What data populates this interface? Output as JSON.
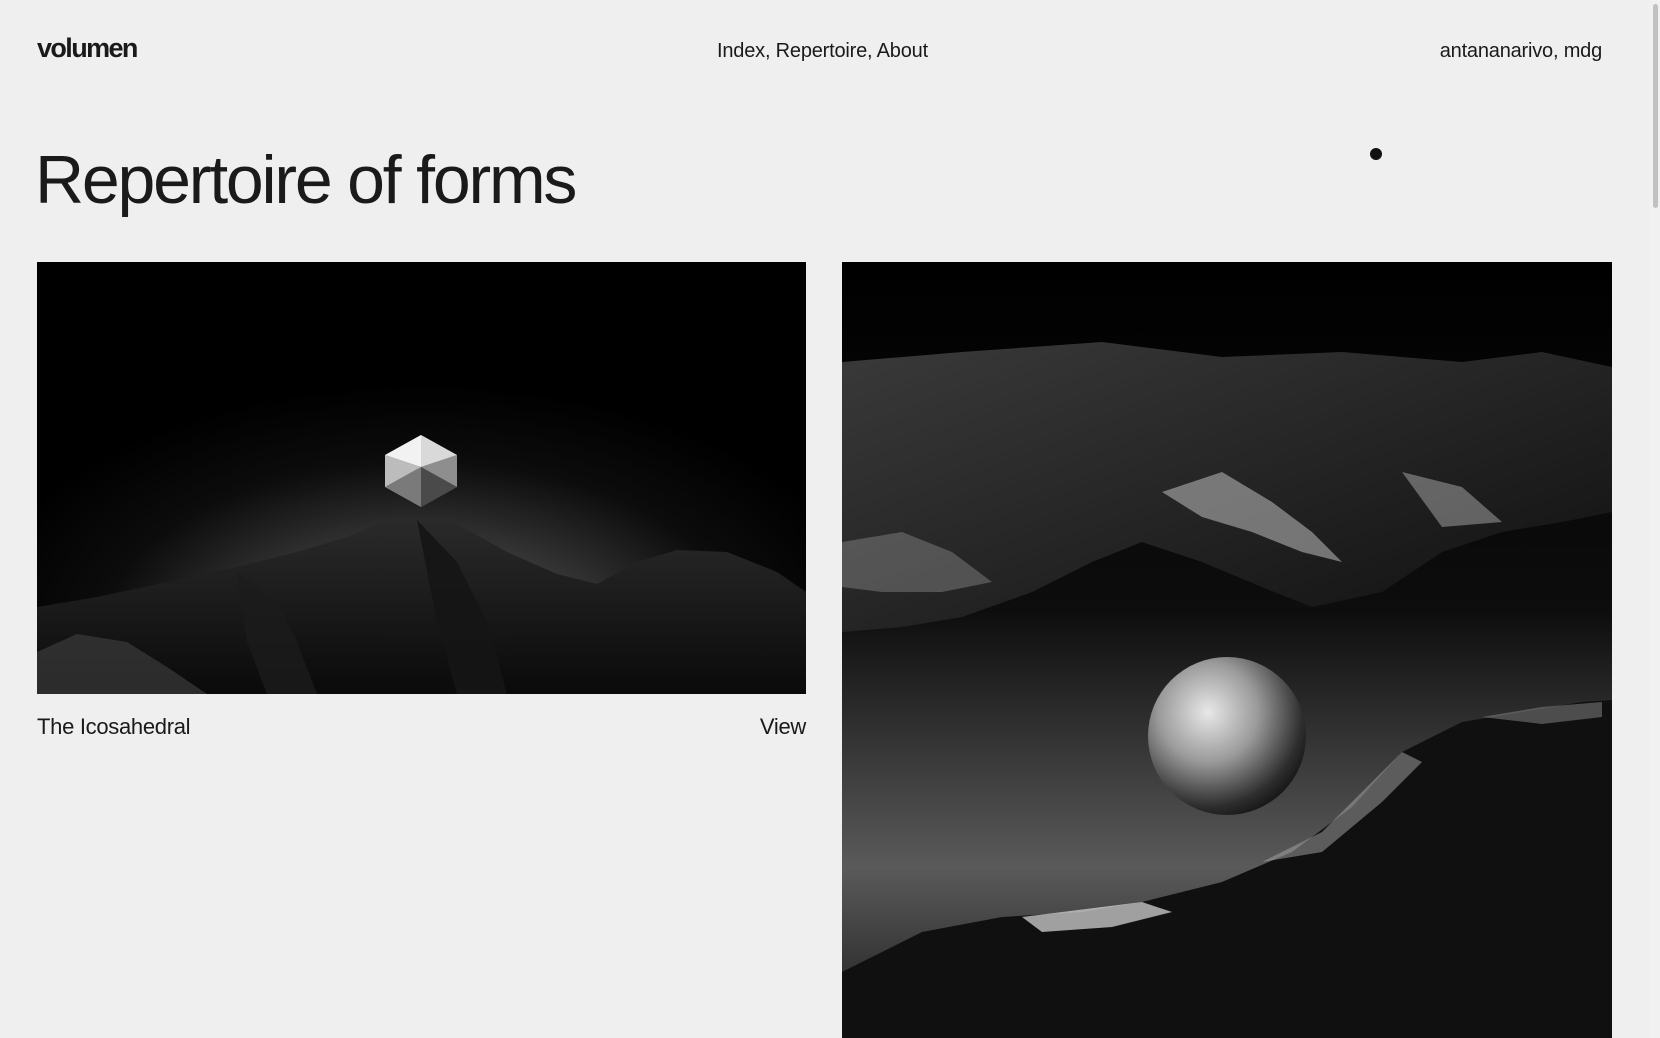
{
  "header": {
    "logo": "volumen",
    "nav": [
      "Index",
      "Repertoire",
      "About"
    ],
    "location": "antananarivo, mdg"
  },
  "page": {
    "title": "Repertoire of forms"
  },
  "cards": [
    {
      "title": "The Icosahedral",
      "action": "View"
    }
  ],
  "colors": {
    "background": "#efefef",
    "text": "#1a1a1a",
    "dot": "#111111"
  }
}
